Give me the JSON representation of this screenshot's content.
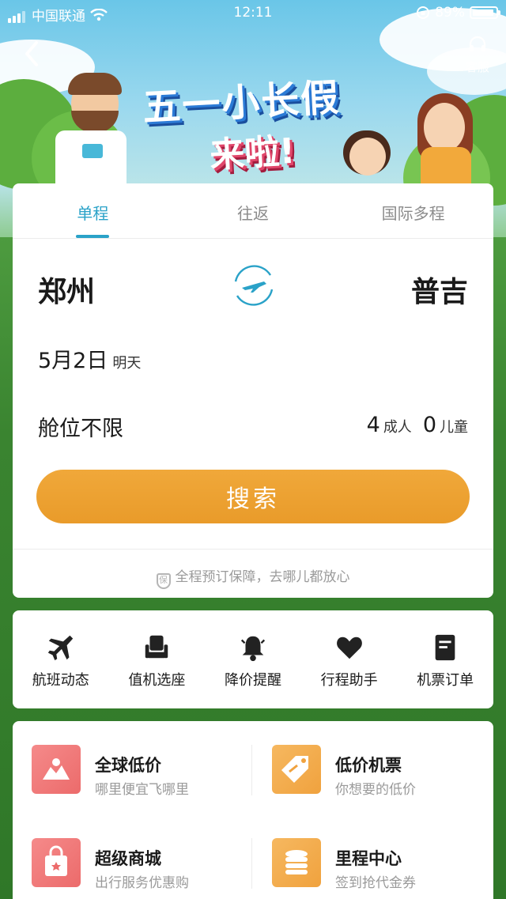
{
  "status_bar": {
    "carrier": "中国联通",
    "time": "12:11",
    "battery": "89%"
  },
  "header": {
    "service_label": "客服"
  },
  "banner": {
    "line1": "五一小长假",
    "line2": "来啦!"
  },
  "tabs": [
    {
      "label": "单程",
      "active": true
    },
    {
      "label": "往返",
      "active": false
    },
    {
      "label": "国际多程",
      "active": false
    }
  ],
  "route": {
    "from": "郑州",
    "to": "普吉"
  },
  "date": {
    "value": "5月2日",
    "day": "明天"
  },
  "cabin": {
    "label": "舱位不限"
  },
  "passengers": {
    "adults": "4",
    "adults_label": "成人",
    "children": "0",
    "children_label": "儿童"
  },
  "search_button": "搜索",
  "guarantee": {
    "badge": "保",
    "text": "全程预订保障，去哪儿都放心"
  },
  "quick_actions": [
    {
      "label": "航班动态",
      "icon": "plane-icon"
    },
    {
      "label": "值机选座",
      "icon": "seat-icon"
    },
    {
      "label": "降价提醒",
      "icon": "bell-icon"
    },
    {
      "label": "行程助手",
      "icon": "heart-icon"
    },
    {
      "label": "机票订单",
      "icon": "document-icon"
    }
  ],
  "services": [
    {
      "title": "全球低价",
      "subtitle": "哪里便宜飞哪里",
      "icon": "map-icon",
      "color": "#ec6b6b"
    },
    {
      "title": "低价机票",
      "subtitle": "你想要的低价",
      "icon": "tag-icon",
      "color": "#f0a23e"
    },
    {
      "title": "超级商城",
      "subtitle": "出行服务优惠购",
      "icon": "shopping-bag-icon",
      "color": "#ec6b6b"
    },
    {
      "title": "里程中心",
      "subtitle": "签到抢代金券",
      "icon": "coins-icon",
      "color": "#f0a23e"
    }
  ],
  "colors": {
    "accent": "#2aa2c8",
    "search": "#eda032",
    "ground": "#3e8a35"
  }
}
